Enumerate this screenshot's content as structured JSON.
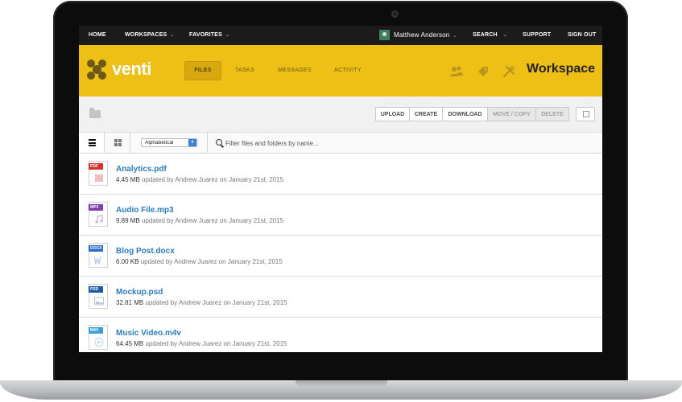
{
  "topnav": {
    "home": "HOME",
    "workspaces": "WORKSPACES",
    "favorites": "FAVORITES",
    "user": "Matthew Anderson",
    "search": "SEARCH",
    "support": "SUPPORT",
    "signout": "SIGN OUT"
  },
  "header": {
    "logo": "venti",
    "tabs": [
      "FILES",
      "TASKS",
      "MESSAGES",
      "ACTIVITY"
    ],
    "active_tab": "FILES",
    "title": "Workspace",
    "icons": [
      "users-icon",
      "tag-icon",
      "tools-icon"
    ]
  },
  "toolbar": {
    "upload": "UPLOAD",
    "create": "CREATE",
    "download": "DOWNLOAD",
    "move_copy": "MOVE / COPY",
    "delete": "DELETE"
  },
  "filter": {
    "sort_value": "Alphabetical",
    "search_placeholder": "Filter files and folders by name..."
  },
  "files": [
    {
      "name": "Analytics.pdf",
      "type": "PDF",
      "color": "#d9322b",
      "size": "4.45 MB",
      "meta": "updated by Andrew Juarez on January 21st, 2015"
    },
    {
      "name": "Audio File.mp3",
      "type": "MP3",
      "color": "#7d3fb0",
      "size": "9.89 MB",
      "meta": "updated by Andrew Juarez on January 21st, 2015"
    },
    {
      "name": "Blog Post.docx",
      "type": "DOCX",
      "color": "#2b6cc4",
      "size": "6.00 KB",
      "meta": "updated by Andrew Juarez on January 21st, 2015"
    },
    {
      "name": "Mockup.psd",
      "type": "PSD",
      "color": "#1f5aa8",
      "size": "32.81 MB",
      "meta": "updated by Andrew Juarez on January 21st, 2015"
    },
    {
      "name": "Music Video.m4v",
      "type": "M4V",
      "color": "#3a9fd8",
      "size": "64.45 MB",
      "meta": "updated by Andrew Juarez on January 21st, 2015"
    }
  ],
  "colors": {
    "header_bg": "#eebf14",
    "topnav_bg": "#1b1b1b",
    "link": "#2b7dc4"
  }
}
